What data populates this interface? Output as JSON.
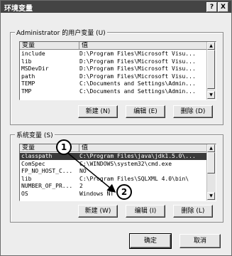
{
  "window": {
    "title": "环境变量",
    "help_button": "?",
    "close_button": "X"
  },
  "user_vars": {
    "group_label": "Administrator 的用户变量 (U)",
    "col_variable": "变量",
    "col_value": "值",
    "rows": [
      {
        "name": "include",
        "value": "D:\\Program Files\\Microsoft Visu..."
      },
      {
        "name": "lib",
        "value": "D:\\Program Files\\Microsoft Visu..."
      },
      {
        "name": "MSDevDir",
        "value": "D:\\Program Files\\Microsoft Visu..."
      },
      {
        "name": "path",
        "value": "D:\\Program Files\\Microsoft Visu..."
      },
      {
        "name": "TEMP",
        "value": "C:\\Documents and Settings\\Admin..."
      },
      {
        "name": "TMP",
        "value": "C:\\Documents and Settings\\Admin..."
      }
    ],
    "buttons": {
      "new": "新建 (N)",
      "edit": "编辑 (E)",
      "delete": "删除 (D)"
    }
  },
  "system_vars": {
    "group_label": "系统变量 (S)",
    "col_variable": "变量",
    "col_value": "值",
    "rows": [
      {
        "name": "classpath",
        "value": "C:\\Program Files\\java\\jdk1.5.0\\...",
        "selected": true
      },
      {
        "name": "ComSpec",
        "value": "C:\\WINDOWS\\system32\\cmd.exe"
      },
      {
        "name": "FP_NO_HOST_C...",
        "value": "NO"
      },
      {
        "name": "lib",
        "value": "C:\\Program Files\\SQLXML 4.0\\bin\\"
      },
      {
        "name": "NUMBER_OF_PR...",
        "value": "2"
      },
      {
        "name": "OS",
        "value": "Windows NT"
      }
    ],
    "buttons": {
      "new": "新建 (W)",
      "edit": "编辑 (I)",
      "delete": "删除 (L)"
    }
  },
  "dialog_buttons": {
    "ok": "确定",
    "cancel": "取消"
  },
  "callouts": {
    "first": "1",
    "second": "2"
  }
}
